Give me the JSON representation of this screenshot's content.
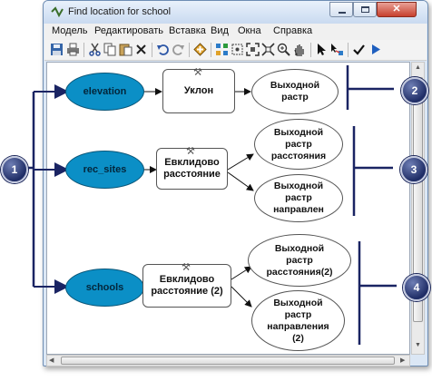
{
  "window": {
    "title": "Find location for school",
    "close_glyph": "✕"
  },
  "menu": [
    "Модель",
    "Редактировать",
    "Вставка",
    "Вид",
    "Окна",
    "Справка"
  ],
  "toolbar_icons": [
    "save-icon",
    "print-icon",
    "cut-icon",
    "copy-icon",
    "paste-icon",
    "delete-icon",
    "undo-icon",
    "redo-icon",
    "add-data-icon",
    "auto-layout-icon",
    "full-extent-icon",
    "zoom-extent-icon",
    "fixed-zoom-icon",
    "zoom-in-icon",
    "pan-icon",
    "select-icon",
    "connect-icon",
    "validate-icon",
    "run-icon"
  ],
  "diagram": {
    "inputs": [
      "elevation",
      "rec_sites",
      "schools"
    ],
    "tools": [
      "Уклон",
      "Евклидово\nрасстояние",
      "Евклидово\nрасстояние (2)"
    ],
    "outputs": [
      "Выходной\nрастр",
      "Выходной\nрастр\nрасстояния",
      "Выходной\nрастр\nнаправлен",
      "Выходной\nрастр\nрасстояния(2)",
      "Выходной\nрастр\nнаправления\n(2)"
    ]
  },
  "callouts": [
    "1",
    "2",
    "3",
    "4"
  ],
  "colors": {
    "input_fill": "#0b8fc6",
    "callout": "#1f2d66",
    "bracket": "#1a2463"
  }
}
